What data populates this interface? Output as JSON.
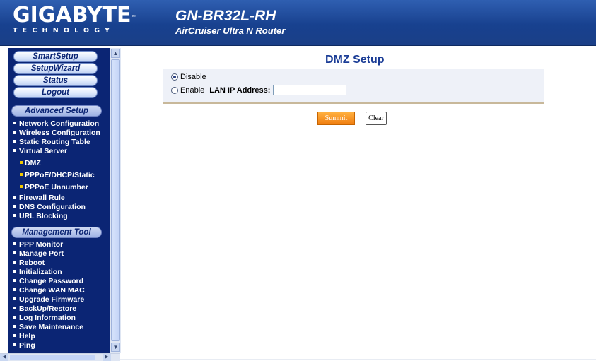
{
  "header": {
    "logo_main": "GIGABYTE",
    "logo_tm": "™",
    "logo_sub": "TECHNOLOGY",
    "model": "GN-BR32L-RH",
    "product": "AirCruiser Ultra N Router"
  },
  "sidebar": {
    "top_buttons": [
      "SmartSetup",
      "SetupWizard",
      "Status",
      "Logout"
    ],
    "advanced_title": "Advanced Setup",
    "advanced_items": [
      "Network Configuration",
      "Wireless Configuration",
      "Static Routing Table",
      "Virtual Server"
    ],
    "virtual_server_sub": [
      "DMZ",
      "PPPoE/DHCP/Static",
      "PPPoE Unnumber"
    ],
    "advanced_items_2": [
      "Firewall Rule",
      "DNS Configuration",
      "URL Blocking"
    ],
    "management_title": "Management Tool",
    "management_items": [
      "PPP Monitor",
      "Manage Port",
      "Reboot",
      "Initialization",
      "Change Password",
      "Change WAN MAC",
      "Upgrade Firmware",
      "BackUp/Restore",
      "Log Information",
      "Save Maintenance",
      "Help",
      "Ping"
    ]
  },
  "main": {
    "title": "DMZ Setup",
    "disable_label": "Disable",
    "enable_label": "Enable",
    "ip_label": "LAN IP Address:",
    "ip_value": "",
    "selected": "Disable",
    "submit_label": "Summit",
    "clear_label": "Clear"
  },
  "icons": {
    "scroll_up": "▲",
    "scroll_down": "▼",
    "scroll_left": "◀",
    "scroll_right": "▶"
  },
  "colors": {
    "header_blue": "#18418f",
    "sidebar_navy": "#0b2574",
    "title_blue": "#1b3d96",
    "submit_orange": "#f07d10"
  }
}
